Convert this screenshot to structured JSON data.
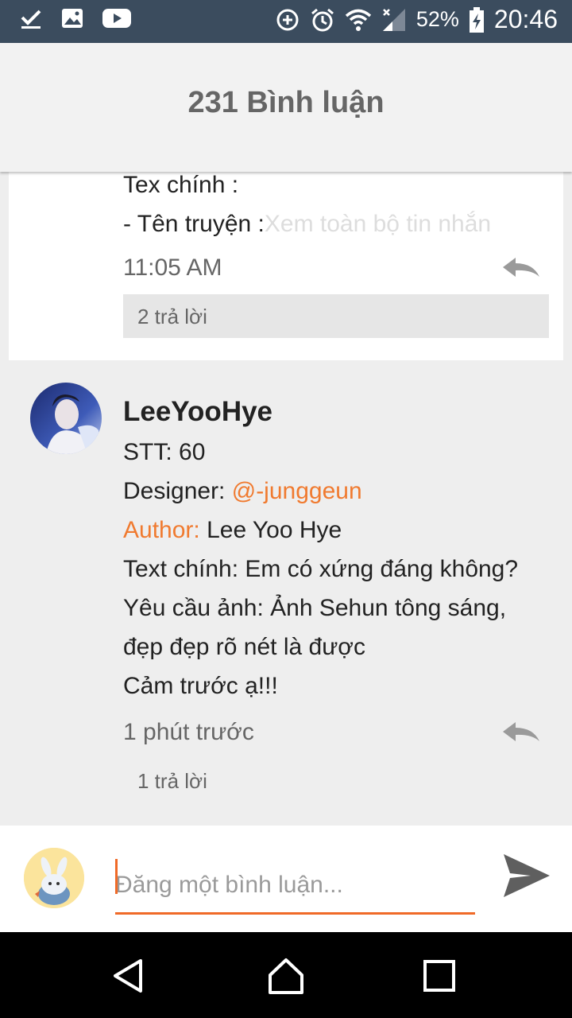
{
  "status_bar": {
    "battery": "52%",
    "time": "20:46",
    "left_icons": [
      "checkmark-download-icon",
      "image-icon",
      "youtube-icon"
    ],
    "right_icons": [
      "data-saver-icon",
      "alarm-icon",
      "wifi-icon",
      "signal-icon",
      "battery-charging-icon"
    ]
  },
  "header": {
    "title": "231 Bình luận"
  },
  "previous_comment": {
    "line1": "Tex chính :",
    "line2_prefix": "- Tên truyện :",
    "see_all": "Xem toàn bộ tin nhắn",
    "time": "11:05 AM",
    "replies": "2 trả lời"
  },
  "comment": {
    "username": "LeeYooHye",
    "stt": "STT: 60",
    "designer_label": "Designer: ",
    "designer_mention": "@-junggeun",
    "author_label": "Author:",
    "author_value": " Lee Yoo Hye",
    "text_main": "Text chính: Em có xứng đáng không?",
    "request_line1": "Yêu cầu ảnh: Ảnh Sehun tông sáng,",
    "request_line2": "đẹp đẹp rõ nét là được",
    "thanks": "Cảm trước ạ!!!",
    "time": "1 phút trước",
    "replies": "1 trả lời"
  },
  "composer": {
    "placeholder": "Đăng một bình luận..."
  },
  "colors": {
    "accent": "#f07a2f",
    "status_bar": "#3b4c5e",
    "header_bg": "#f2f2f2",
    "page_bg": "#eeeeee"
  }
}
